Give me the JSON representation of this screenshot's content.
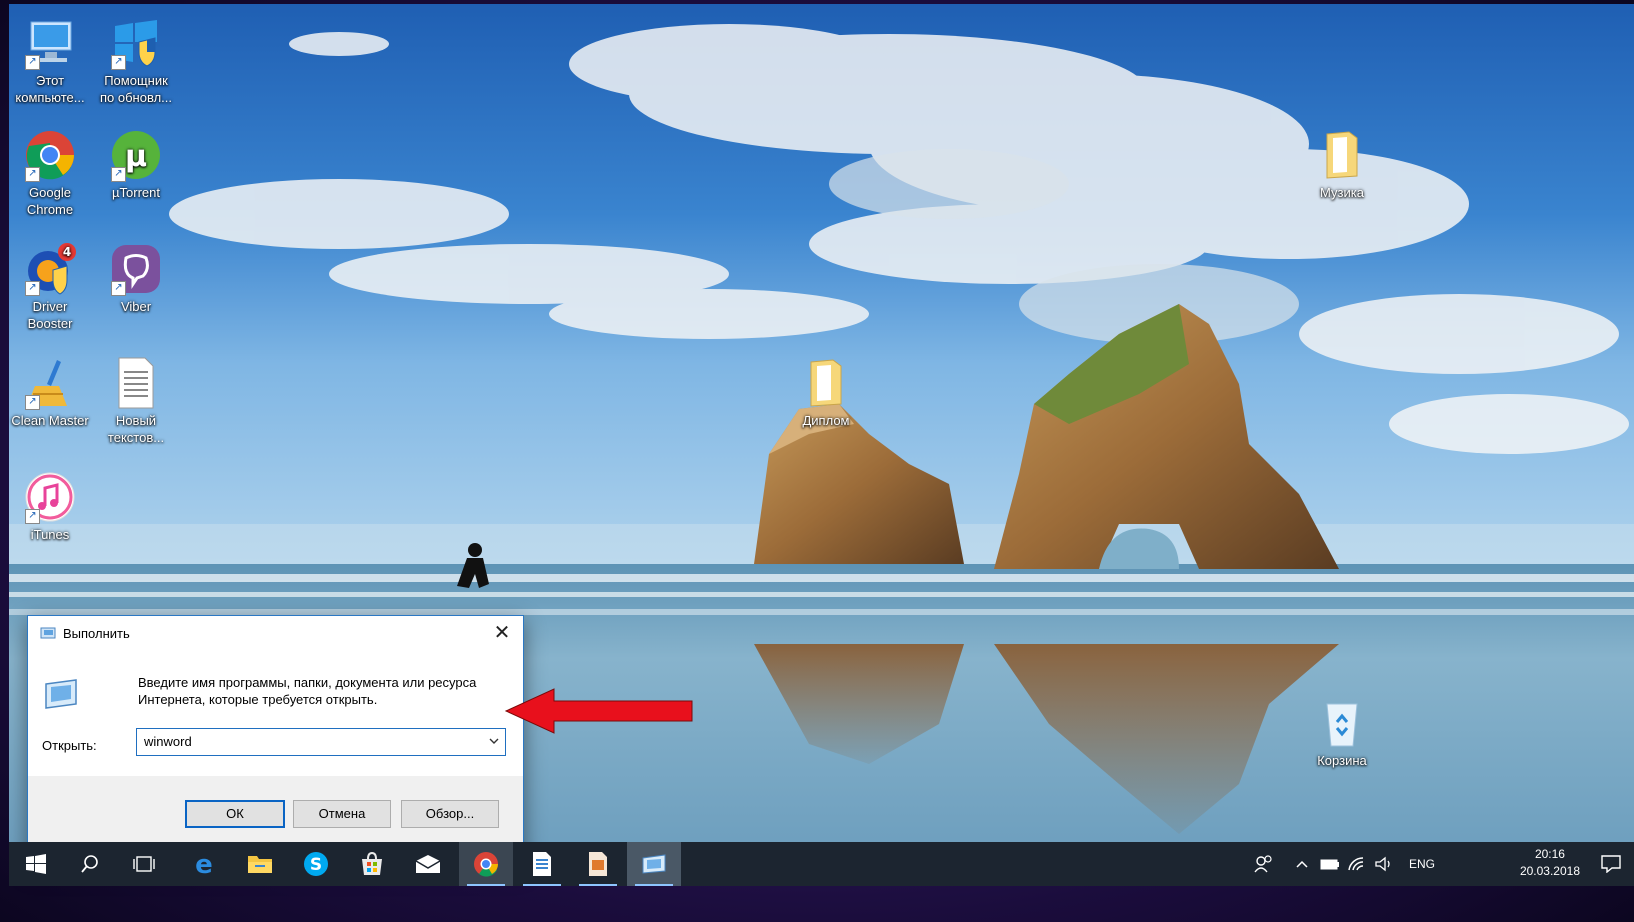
{
  "desktop": {
    "icons": [
      {
        "label_line1": "Этот",
        "label_line2": "компьюте..."
      },
      {
        "label_line1": "Помощник",
        "label_line2": "по обновл..."
      },
      {
        "label_line1": "Google",
        "label_line2": "Chrome"
      },
      {
        "label_line1": "µTorrent",
        "label_line2": ""
      },
      {
        "label_line1": "Driver",
        "label_line2": "Booster",
        "badge": "4"
      },
      {
        "label_line1": "Viber",
        "label_line2": ""
      },
      {
        "label_line1": "Clean Master",
        "label_line2": ""
      },
      {
        "label_line1": "Новый",
        "label_line2": "текстов..."
      },
      {
        "label_line1": "iTunes",
        "label_line2": ""
      },
      {
        "label_line1": "Диплом",
        "label_line2": ""
      },
      {
        "label_line1": "Музика",
        "label_line2": ""
      },
      {
        "label_line1": "Корзина",
        "label_line2": ""
      }
    ]
  },
  "run_dialog": {
    "title": "Выполнить",
    "close_glyph": "✕",
    "description_line1": "Введите имя программы, папки, документа или ресурса",
    "description_line2": "Интернета, которые требуется открыть.",
    "open_label": "Открыть:",
    "open_value": "winword",
    "ok_label": "ОК",
    "cancel_label": "Отмена",
    "browse_label": "Обзор..."
  },
  "taskbar": {
    "language": "ENG",
    "time": "20:16",
    "date": "20.03.2018"
  },
  "colors": {
    "taskbar_bg": "#1c2530",
    "dialog_accent": "#0a64c4",
    "arrow": "#e8101c"
  }
}
